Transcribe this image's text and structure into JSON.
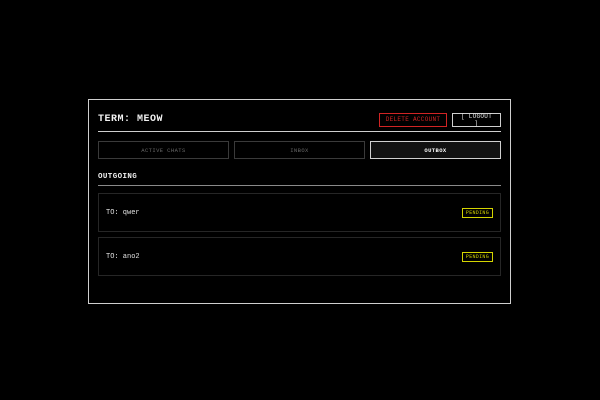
{
  "header": {
    "title": "TERM: MEOW",
    "delete_label": "DELETE ACCOUNT",
    "logout_label": "[ LOGOUT ]"
  },
  "tabs": [
    {
      "label": "ACTIVE CHATS",
      "active": false
    },
    {
      "label": "INBOX",
      "active": false
    },
    {
      "label": "OUTBOX",
      "active": true
    }
  ],
  "section": {
    "title": "OUTGOING"
  },
  "outgoing": [
    {
      "recipient_label": "TO: qwer",
      "status": "PENDING"
    },
    {
      "recipient_label": "TO: ano2",
      "status": "PENDING"
    }
  ],
  "colors": {
    "background": "#000000",
    "border": "#cfcfcf",
    "danger": "#d12424",
    "pending": "#d4d400"
  }
}
